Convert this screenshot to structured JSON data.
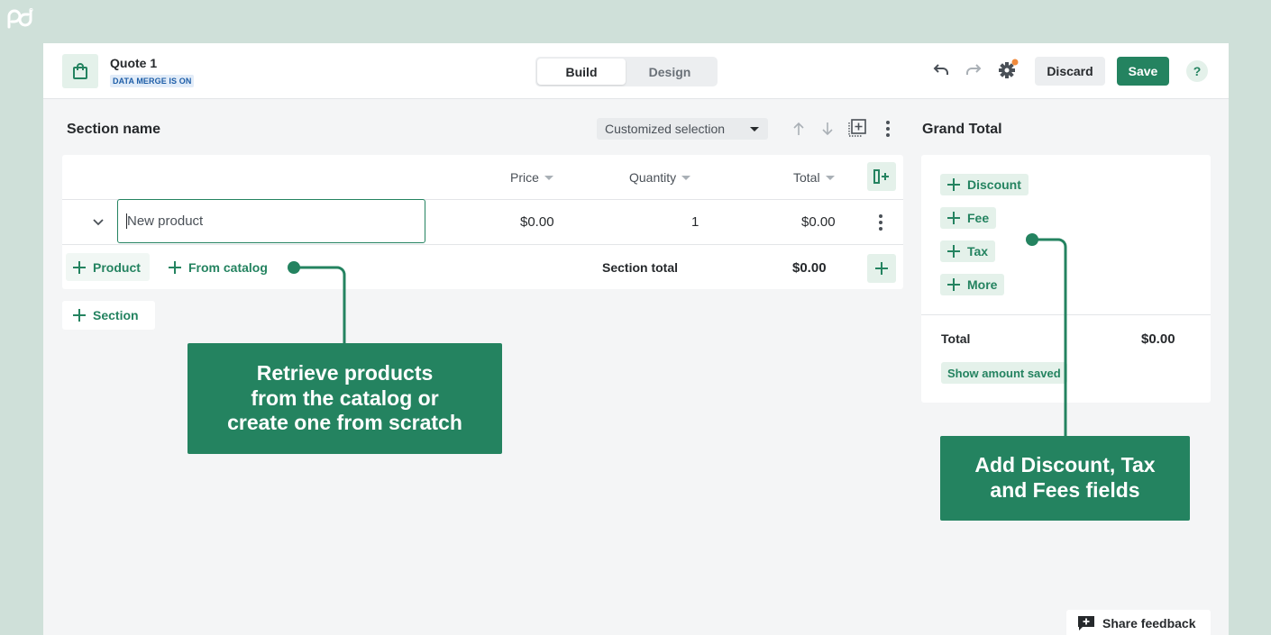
{
  "header": {
    "quote_title": "Quote 1",
    "merge_badge": "DATA MERGE IS ON",
    "tabs": [
      {
        "label": "Build"
      },
      {
        "label": "Design"
      }
    ],
    "discard_label": "Discard",
    "save_label": "Save",
    "help_label": "?"
  },
  "section": {
    "name": "Section name",
    "selection": "Customized selection",
    "columns": [
      {
        "label": "Price"
      },
      {
        "label": "Quantity"
      },
      {
        "label": "Total"
      }
    ],
    "rows": [
      {
        "product_placeholder": "New product",
        "price": "$0.00",
        "quantity": "1",
        "total": "$0.00"
      }
    ],
    "add_product_label": "Product",
    "from_catalog_label": "From catalog",
    "section_total_label": "Section total",
    "section_total_value": "$0.00",
    "add_section_label": "Section"
  },
  "grand_total": {
    "title": "Grand Total",
    "chips": [
      {
        "label": "Discount"
      },
      {
        "label": "Fee"
      },
      {
        "label": "Tax"
      },
      {
        "label": "More"
      }
    ],
    "total_label": "Total",
    "total_value": "$0.00",
    "show_saved_label": "Show amount saved"
  },
  "feedback_label": "Share feedback",
  "callouts": {
    "catalog": [
      "Retrieve products",
      "from the catalog or",
      "create one from scratch"
    ],
    "fees": [
      "Add Discount, Tax",
      "and Fees fields"
    ]
  },
  "colors": {
    "background": "#cfe0d9",
    "accent": "#248360",
    "badge_blue": "#1e5ea8",
    "notification_dot": "#f08a3c"
  },
  "icons": {
    "logo": "pandadoc-logo",
    "document": "shopping-bag-icon",
    "undo": "undo-icon",
    "redo": "redo-icon",
    "settings": "gear-icon",
    "move_up": "arrow-up-icon",
    "move_down": "arrow-down-icon",
    "add_block": "add-block-icon",
    "more": "kebab-menu-icon",
    "add_column": "add-column-icon",
    "expand": "chevron-down-icon",
    "feedback": "feedback-icon"
  }
}
